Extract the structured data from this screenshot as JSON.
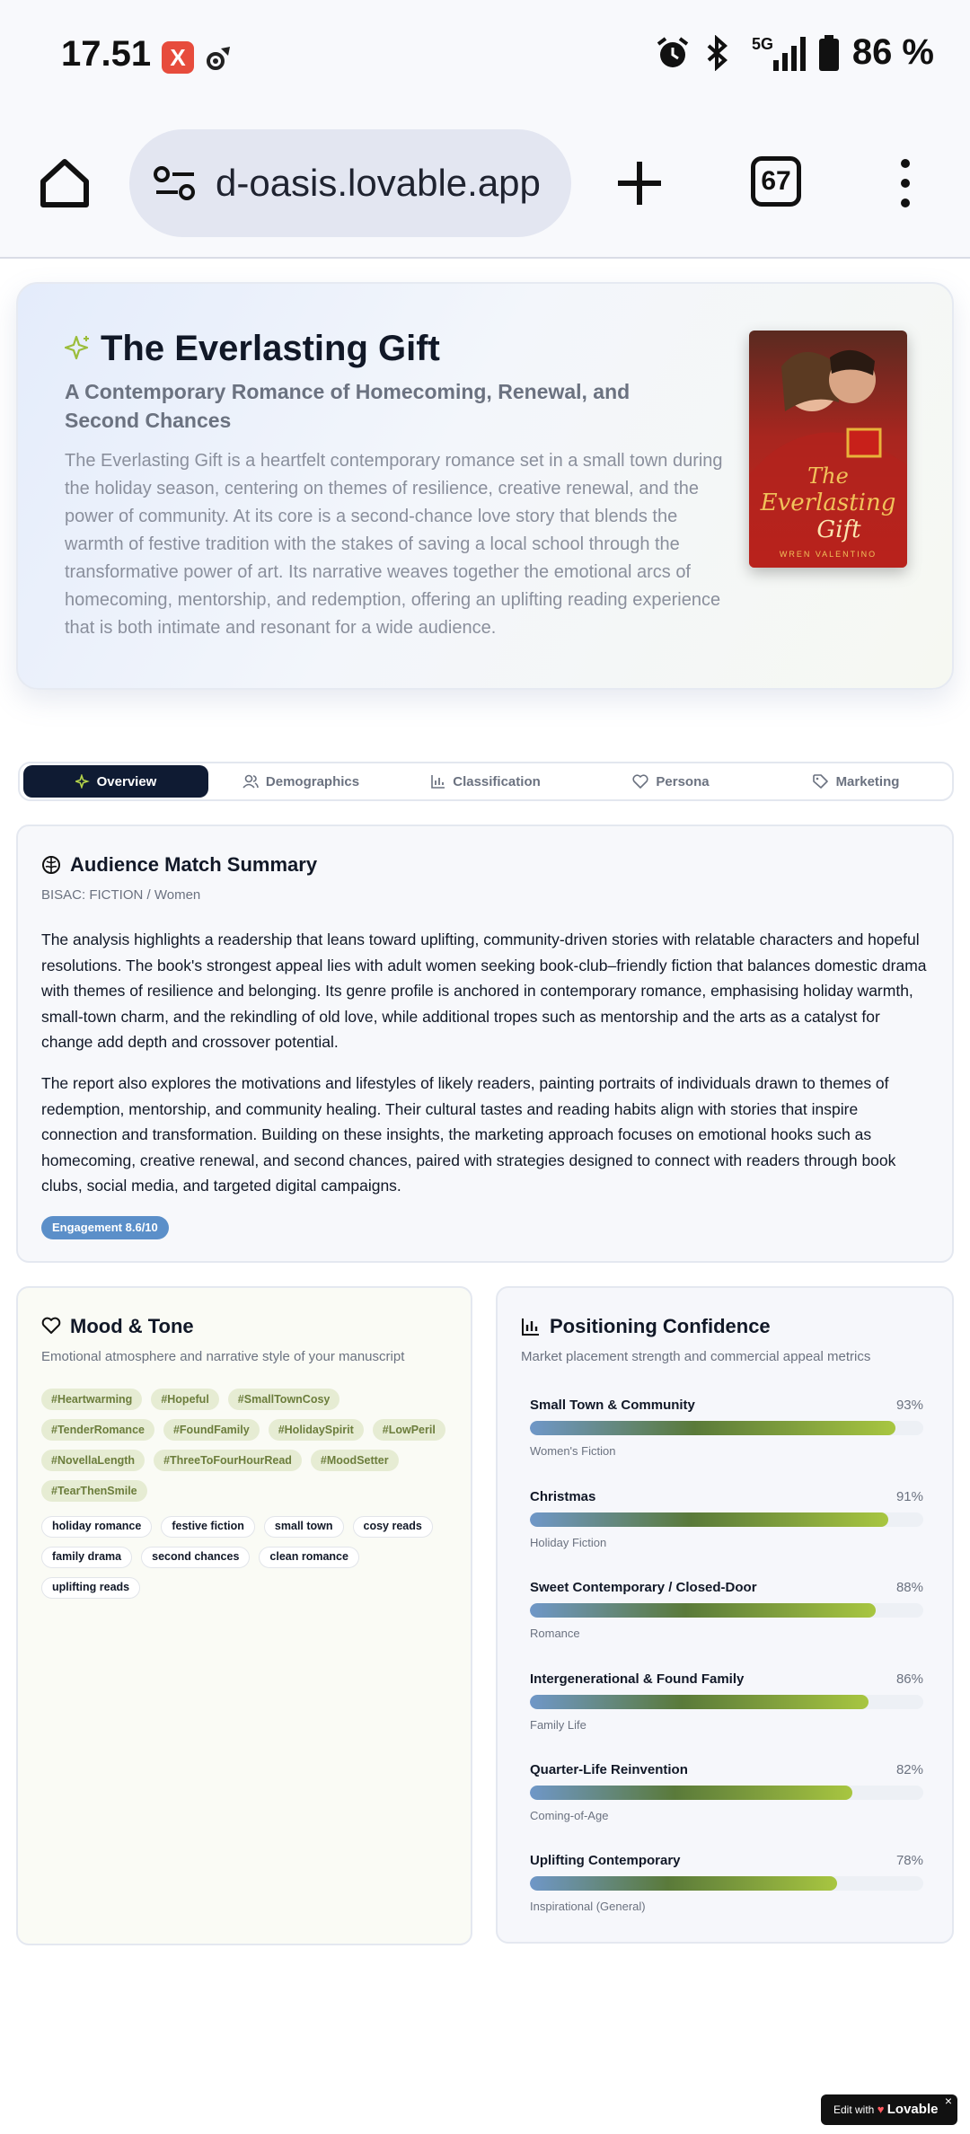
{
  "status": {
    "time": "17.51",
    "x_badge": "X",
    "battery": "86 %",
    "network": "5G"
  },
  "browser": {
    "url": "d-oasis.lovable.app",
    "tabs_count": "67"
  },
  "hero": {
    "title": "The Everlasting Gift",
    "subtitle": "A Contemporary Romance of Homecoming, Renewal, and Second Chances",
    "description": "The Everlasting Gift is a heartfelt contemporary romance set in a small town during the holiday season, centering on themes of resilience, creative renewal, and the power of community. At its core is a second-chance love story that blends the warmth of festive tradition with the stakes of saving a local school through the transformative power of art. Its narrative weaves together the emotional arcs of homecoming, mentorship, and redemption, offering an uplifting reading experience that is both intimate and resonant for a wide audience.",
    "cover": {
      "title_line1": "The",
      "title_line2": "Everlasting",
      "title_line3": "Gift",
      "author": "WREN VALENTINO"
    }
  },
  "tabs": [
    {
      "label": "Overview",
      "icon": "sparkle-icon"
    },
    {
      "label": "Demographics",
      "icon": "users-icon"
    },
    {
      "label": "Classification",
      "icon": "bar-chart-icon"
    },
    {
      "label": "Persona",
      "icon": "heart-icon"
    },
    {
      "label": "Marketing",
      "icon": "tag-icon"
    }
  ],
  "summary": {
    "title": "Audience Match Summary",
    "bisac": "BISAC: FICTION / Women",
    "para1": "The analysis highlights a readership that leans toward uplifting, community-driven stories with relatable characters and hopeful resolutions. The book's strongest appeal lies with adult women seeking book-club–friendly fiction that balances domestic drama with themes of resilience and belonging. Its genre profile is anchored in contemporary romance, emphasising holiday warmth, small-town charm, and the rekindling of old love, while additional tropes such as mentorship and the arts as a catalyst for change add depth and crossover potential.",
    "para2": "The report also explores the motivations and lifestyles of likely readers, painting portraits of individuals drawn to themes of redemption, mentorship, and community healing. Their cultural tastes and reading habits align with stories that inspire connection and transformation. Building on these insights, the marketing approach focuses on emotional hooks such as homecoming, creative renewal, and second chances, paired with strategies designed to connect with readers through book clubs, social media, and targeted digital campaigns.",
    "engagement": "Engagement 8.6/10"
  },
  "mood": {
    "title": "Mood & Tone",
    "subtitle": "Emotional atmosphere and narrative style of your manuscript",
    "hashtags": [
      "#Heartwarming",
      "#Hopeful",
      "#SmallTownCosy",
      "#TenderRomance",
      "#FoundFamily",
      "#HolidaySpirit",
      "#LowPeril",
      "#NovellaLength",
      "#ThreeToFourHourRead",
      "#MoodSetter",
      "#TearThenSmile"
    ],
    "keywords": [
      "holiday romance",
      "festive fiction",
      "small town",
      "cosy reads",
      "family drama",
      "second chances",
      "clean romance",
      "uplifting reads"
    ]
  },
  "positioning": {
    "title": "Positioning Confidence",
    "subtitle": "Market placement strength and commercial appeal metrics",
    "items": [
      {
        "label": "Small Town & Community",
        "pct": "93%",
        "value": 0.93,
        "category": "Women's Fiction"
      },
      {
        "label": "Christmas",
        "pct": "91%",
        "value": 0.91,
        "category": "Holiday Fiction"
      },
      {
        "label": "Sweet Contemporary / Closed-Door",
        "pct": "88%",
        "value": 0.88,
        "category": "Romance"
      },
      {
        "label": "Intergenerational & Found Family",
        "pct": "86%",
        "value": 0.86,
        "category": "Family Life"
      },
      {
        "label": "Quarter-Life Reinvention",
        "pct": "82%",
        "value": 0.82,
        "category": "Coming-of-Age"
      },
      {
        "label": "Uplifting Contemporary",
        "pct": "78%",
        "value": 0.78,
        "category": "Inspirational (General)"
      }
    ]
  },
  "badge": {
    "prefix": "Edit with",
    "brand": "Lovable",
    "close": "×"
  }
}
